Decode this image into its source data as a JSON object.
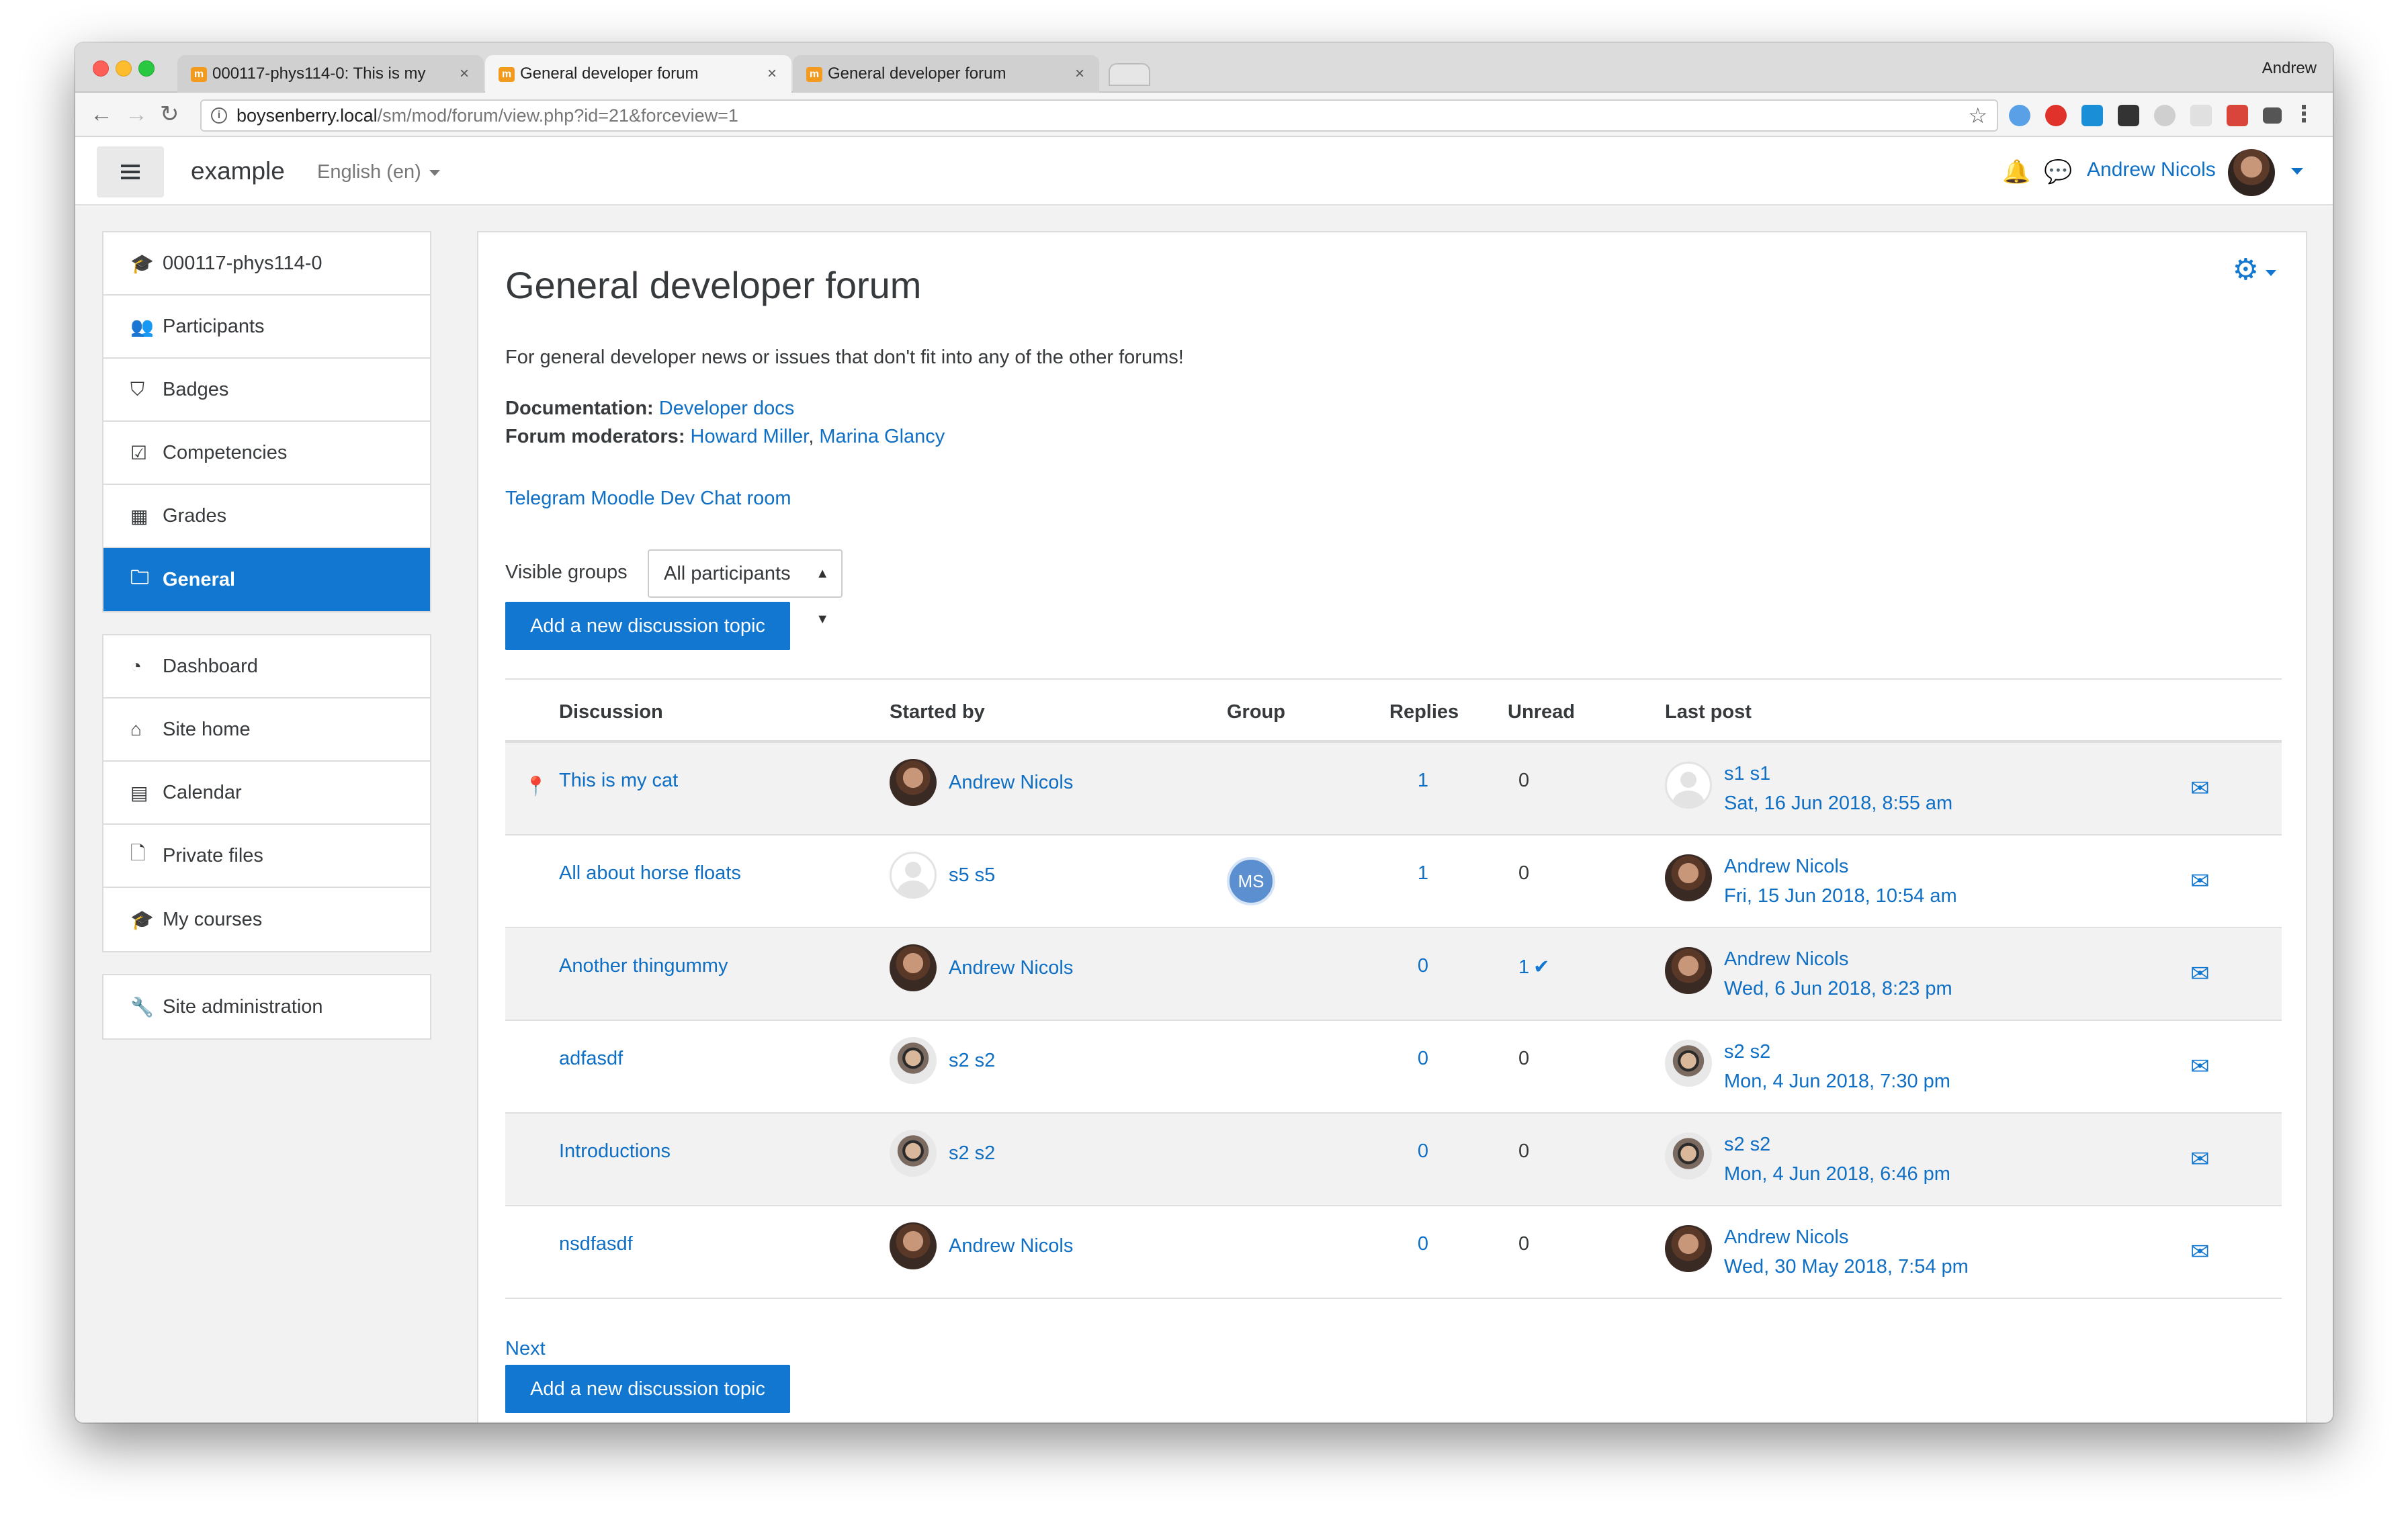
{
  "browser": {
    "tabs": [
      {
        "title": "000117-phys114-0: This is my",
        "active": false
      },
      {
        "title": "General developer forum",
        "active": true
      },
      {
        "title": "General developer forum",
        "active": false
      }
    ],
    "profile": "Andrew",
    "url_host": "boysenberry.local",
    "url_path": "/sm/mod/forum/view.php?id=21&forceview=1"
  },
  "navbar": {
    "brand": "example",
    "language": "English (en)",
    "user_name": "Andrew Nicols"
  },
  "drawer": {
    "course_items": [
      {
        "label": "000117-phys114-0",
        "icon": "graduation-cap-icon",
        "glyph": "🎓"
      },
      {
        "label": "Participants",
        "icon": "users-icon",
        "glyph": "👥"
      },
      {
        "label": "Badges",
        "icon": "shield-icon",
        "glyph": "⛉"
      },
      {
        "label": "Competencies",
        "icon": "check-square-icon",
        "glyph": "☑"
      },
      {
        "label": "Grades",
        "icon": "table-icon",
        "glyph": "▦"
      },
      {
        "label": "General",
        "icon": "folder-icon",
        "glyph": "🗀",
        "active": true
      }
    ],
    "site_items": [
      {
        "label": "Dashboard",
        "icon": "tachometer-icon",
        "glyph": "◔"
      },
      {
        "label": "Site home",
        "icon": "home-icon",
        "glyph": "⌂"
      },
      {
        "label": "Calendar",
        "icon": "calendar-icon",
        "glyph": "▤"
      },
      {
        "label": "Private files",
        "icon": "file-icon",
        "glyph": "🗋"
      },
      {
        "label": "My courses",
        "icon": "graduation-cap-icon",
        "glyph": "🎓"
      }
    ],
    "admin_items": [
      {
        "label": "Site administration",
        "icon": "wrench-icon",
        "glyph": "🔧"
      }
    ]
  },
  "forum": {
    "title": "General developer forum",
    "intro": "For general developer news or issues that don't fit into any of the other forums!",
    "documentation_label": "Documentation:",
    "documentation_link": "Developer docs",
    "moderators_label": "Forum moderators:",
    "moderator_1": "Howard Miller",
    "moderator_sep": ",",
    "moderator_2": "Marina Glancy",
    "telegram_link": "Telegram Moodle Dev Chat room",
    "groups_label": "Visible groups",
    "groups_selected": "All participants",
    "add_topic_label": "Add a new discussion topic",
    "next_label": "Next"
  },
  "table": {
    "headers": {
      "discussion": "Discussion",
      "started_by": "Started by",
      "group": "Group",
      "replies": "Replies",
      "unread": "Unread",
      "last_post": "Last post"
    },
    "rows": [
      {
        "discussion": "This is my cat",
        "pinned": true,
        "started_by": "Andrew Nicols",
        "starter_avatar": "an",
        "group": "",
        "replies": "1",
        "unread": "0",
        "unread_check": false,
        "last_author": "s1 s1",
        "last_avatar": "blank",
        "last_date": "Sat, 16 Jun 2018, 8:55 am",
        "subscribed": true
      },
      {
        "discussion": "All about horse floats",
        "pinned": false,
        "started_by": "s5 s5",
        "starter_avatar": "blank",
        "group": "MS",
        "replies": "1",
        "unread": "0",
        "unread_check": false,
        "last_author": "Andrew Nicols",
        "last_avatar": "an",
        "last_date": "Fri, 15 Jun 2018, 10:54 am",
        "subscribed": true
      },
      {
        "discussion": "Another thingummy",
        "pinned": false,
        "started_by": "Andrew Nicols",
        "starter_avatar": "an",
        "group": "",
        "replies": "0",
        "unread": "1",
        "unread_check": true,
        "last_author": "Andrew Nicols",
        "last_avatar": "an",
        "last_date": "Wed, 6 Jun 2018, 8:23 pm",
        "subscribed": true
      },
      {
        "discussion": "adfasdf",
        "pinned": false,
        "started_by": "s2 s2",
        "starter_avatar": "s2",
        "group": "",
        "replies": "0",
        "unread": "0",
        "unread_check": false,
        "last_author": "s2 s2",
        "last_avatar": "s2",
        "last_date": "Mon, 4 Jun 2018, 7:30 pm",
        "subscribed": true
      },
      {
        "discussion": "Introductions",
        "pinned": false,
        "started_by": "s2 s2",
        "starter_avatar": "s2",
        "group": "",
        "replies": "0",
        "unread": "0",
        "unread_check": false,
        "last_author": "s2 s2",
        "last_avatar": "s2",
        "last_date": "Mon, 4 Jun 2018, 6:46 pm",
        "subscribed": false
      },
      {
        "discussion": "nsdfasdf",
        "pinned": false,
        "started_by": "Andrew Nicols",
        "starter_avatar": "an",
        "group": "",
        "replies": "0",
        "unread": "0",
        "unread_check": false,
        "last_author": "Andrew Nicols",
        "last_avatar": "an",
        "last_date": "Wed, 30 May 2018, 7:54 pm",
        "subscribed": false
      }
    ]
  },
  "colors": {
    "primary": "#1177d1",
    "link": "#0f6fc5",
    "page_bg": "#f2f2f2"
  }
}
